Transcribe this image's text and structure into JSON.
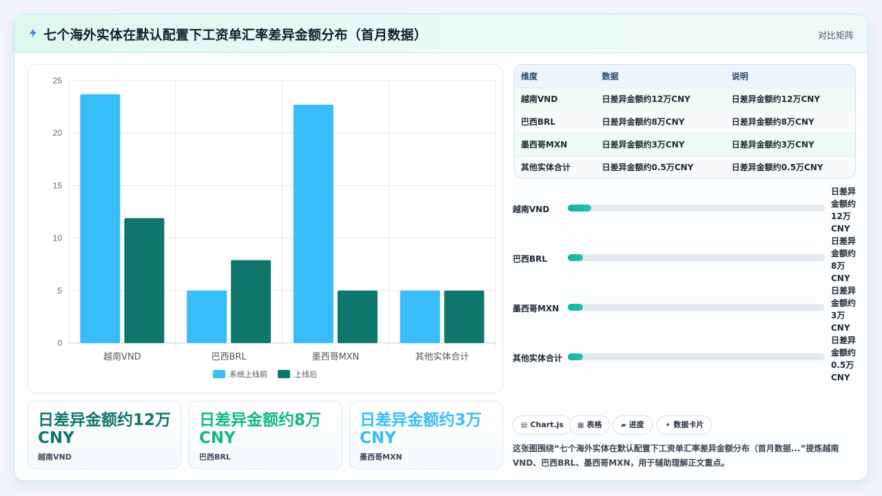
{
  "header": {
    "title": "七个海外实体在默认配置下工资单汇率差异金额分布（首月数据）",
    "right_link": "对比矩阵"
  },
  "chart_data": {
    "type": "bar",
    "categories": [
      "越南VND",
      "巴西BRL",
      "墨西哥MXN",
      "其他实体合计"
    ],
    "series": [
      {
        "name": "系统上线前",
        "values": [
          23.7,
          5,
          22.7,
          5
        ],
        "color": "#38bdf8"
      },
      {
        "name": "上线后",
        "values": [
          11.9,
          7.9,
          5,
          5
        ],
        "color": "#0f766e"
      }
    ],
    "ylim": [
      0,
      25
    ],
    "yticks": [
      0,
      5,
      10,
      15,
      20,
      25
    ],
    "grid": true,
    "legend": "bottom"
  },
  "table": {
    "headers": [
      "维度",
      "数据",
      "说明"
    ],
    "rows": [
      [
        "越南VND",
        "日差异金额约12万CNY",
        "日差异金额约12万CNY"
      ],
      [
        "巴西BRL",
        "日差异金额约8万CNY",
        "日差异金额约8万CNY"
      ],
      [
        "墨西哥MXN",
        "日差异金额约3万CNY",
        "日差异金额约3万CNY"
      ],
      [
        "其他实体合计",
        "日差异金额约0.5万CNY",
        "日差异金额约0.5万CNY"
      ]
    ]
  },
  "progress": [
    {
      "label": "越南VND",
      "value_text": "日差异金额约12万CNY",
      "fraction": 0.09
    },
    {
      "label": "巴西BRL",
      "value_text": "日差异金额约8万CNY",
      "fraction": 0.06
    },
    {
      "label": "墨西哥MXN",
      "value_text": "日差异金额约3万CNY",
      "fraction": 0.06
    },
    {
      "label": "其他实体合计",
      "value_text": "日差异金额约0.5万CNY",
      "fraction": 0.06
    }
  ],
  "stats": [
    {
      "value": "日差异金额约12万CNY",
      "label": "越南VND",
      "color": "#0f766e"
    },
    {
      "value": "日差异金额约8万CNY",
      "label": "巴西BRL",
      "color": "#10b981"
    },
    {
      "value": "日差异金额约3万CNY",
      "label": "墨西哥MXN",
      "color": "#38bdf8"
    }
  ],
  "tags": [
    {
      "icon": "▤",
      "icon_name": "chart-icon",
      "label": "Chart.js"
    },
    {
      "icon": "▦",
      "icon_name": "table-icon",
      "label": "表格"
    },
    {
      "icon": "▰",
      "icon_name": "progress-icon",
      "label": "进度"
    },
    {
      "icon": "✦",
      "icon_name": "sparkle-icon",
      "label": "数据卡片"
    }
  ],
  "description": "这张图围绕“七个海外实体在默认配置下工资单汇率差异金额分布（首月数据...”提炼越南VND、巴西BRL、墨西哥MXN，用于辅助理解正文重点。"
}
